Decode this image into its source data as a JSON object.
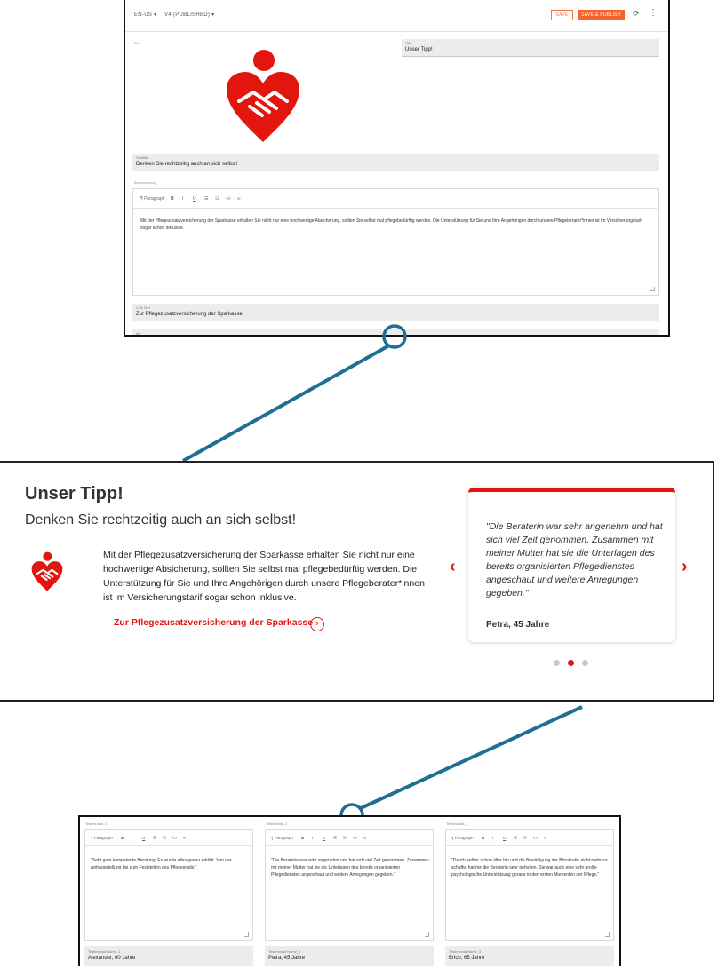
{
  "editor": {
    "locale": "EN-US ▾",
    "version": "V4 (PUBLISHED) ▾",
    "save_label": "SAVE",
    "publish_label": "SAVE & PUBLISH",
    "bild_label": "Bild",
    "title_label": "Title",
    "title_value": "Unser Tipp!",
    "subtitle_label": "Subtitle",
    "subtitle_value": "Denken Sie rechtzeitig auch an sich selbst!",
    "description_label": "Beschreibung",
    "toolbar": {
      "paragraph": "¶ Paragraph",
      "bold": "B",
      "italic": "I",
      "underline": "U",
      "bullets": "☰",
      "numbered": "☷",
      "code": "<>",
      "link": "∞"
    },
    "description_text": "Mit der Pflegezusatzversicherung der Sparkasse erhalten Sie nicht nur eine hochwertige Absicherung, sollten Sie selbst mal pflegebedürftig werden. Die Unterstützung für Sie und Ihre Angehörigen durch unsere Pflegeberater*innen ist im Versicherungstarif sogar schon inklusive.",
    "cta_label": "CTA Text",
    "cta_value": "Zur Pflegezusatzversicherung der Sparkasse",
    "url_label": "url"
  },
  "preview": {
    "title": "Unser Tipp!",
    "subtitle": "Denken Sie rechtzeitig auch an sich selbst!",
    "description": "Mit der Pflegezusatzversicherung der Sparkasse erhalten Sie nicht nur eine hochwertige Absicherung, sollten Sie selbst mal pflegebedürftig werden. Die Unterstützung für Sie und Ihre Angehörigen durch unsere Pflegeberater*innen ist im Versicherungstarif sogar schon inklusive.",
    "cta": "Zur Pflegezusatzversicherung der Sparkasse",
    "testimonial_quote": "\"Die Beraterin war sehr angenehm und hat sich viel Zeit genommen. Zusammen mit meiner Mutter hat sie die Unterlagen des bereits organisierten Pflegedienstes angeschaut und weitere Anregungen gegeben.\"",
    "testimonial_name": "Petra, 45 Jahre",
    "prev_icon": "chevron-left-icon",
    "next_icon": "chevron-right-icon",
    "active_slide": 2,
    "slide_count": 3,
    "brand_color": "#e3150f"
  },
  "testimonials": [
    {
      "label": "Testimonial_1",
      "text": "\"Sehr gute kompetente Beratung. Es wurde alles genau erklärt. Von der Antragsstellung bis zum Feststellen des Pflegegrads.\"",
      "name_label": "Testimonial Name_1",
      "name_value": "Alexander, 60 Jahre"
    },
    {
      "label": "Testimonial_2",
      "text": "\"Die Beraterin war sehr angenehm und hat sich viel Zeit genommen. Zusammen mit meiner Mutter hat sie die Unterlagen des bereits organisierten Pflegedienstes angeschaut und weitere Anregungen gegeben.\"",
      "name_label": "Testimonial Name_2",
      "name_value": "Petra, 45 Jahre"
    },
    {
      "label": "Testimonial_3",
      "text": "\"Da ich selber schon älter bin und die Bewältigung der Bürokratie nicht mehr so schaffe, hat mir die Beraterin sehr geholfen. Sie war auch eine sehr große psychologische Unterstützung gerade in den ersten Momenten der Pflege.\"",
      "name_label": "Testimonial Name_3",
      "name_value": "Erich, 65 Jahre"
    }
  ]
}
